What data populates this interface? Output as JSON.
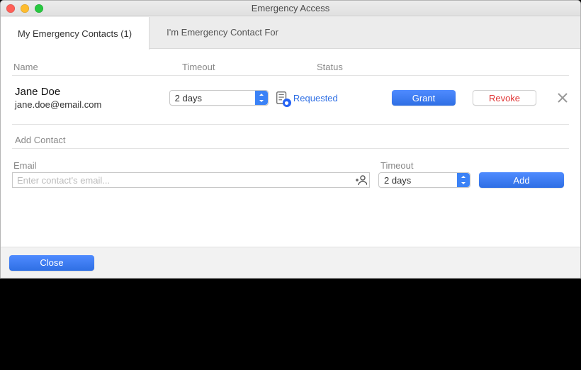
{
  "window": {
    "title": "Emergency Access"
  },
  "tabs": {
    "my_contacts": "My Emergency Contacts (1)",
    "im_contact_for": "I'm Emergency Contact For"
  },
  "columns": {
    "name": "Name",
    "timeout": "Timeout",
    "status": "Status"
  },
  "contact": {
    "name": "Jane Doe",
    "email": "jane.doe@email.com",
    "timeout_selected": "2 days",
    "status": "Requested"
  },
  "actions": {
    "grant": "Grant",
    "revoke": "Revoke"
  },
  "add_contact": {
    "heading": "Add Contact",
    "email_label": "Email",
    "email_placeholder": "Enter contact's email...",
    "timeout_label": "Timeout",
    "timeout_selected": "2 days",
    "add": "Add"
  },
  "footer": {
    "close": "Close"
  }
}
